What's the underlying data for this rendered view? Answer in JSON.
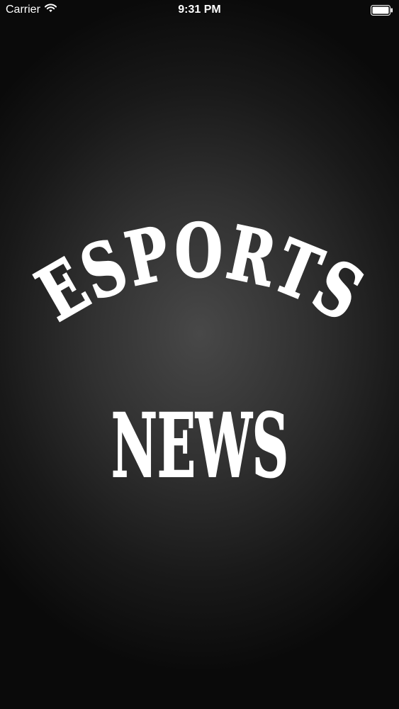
{
  "status_bar": {
    "carrier": "Carrier",
    "time": "9:31 PM",
    "wifi_icon": "wifi-icon",
    "battery_icon": "battery-icon"
  },
  "splash": {
    "logo_line1": "ESPORTS",
    "logo_line2": "NEWS",
    "text_color": "#ffffff",
    "background_center_color": "#484848",
    "background_edge_color": "#0a0a0a"
  }
}
